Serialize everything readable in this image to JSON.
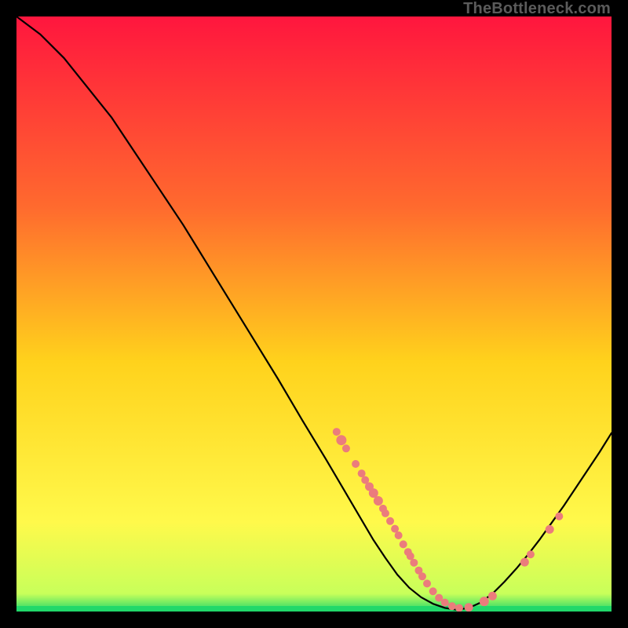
{
  "watermark": "TheBottleneck.com",
  "colors": {
    "curve": "#000000",
    "dots": "#eb7c7c",
    "green": "#21d86a",
    "gradient_top": "#ff163e",
    "gradient_mid_upper": "#ff6a2e",
    "gradient_mid": "#ffd21c",
    "gradient_mid_lower": "#fff94b",
    "gradient_bottom": "#21d86a",
    "frame": "#000000"
  },
  "chart_data": {
    "type": "line",
    "title": "",
    "xlabel": "",
    "ylabel": "",
    "xlim": [
      0,
      100
    ],
    "ylim": [
      0,
      100
    ],
    "curve": [
      {
        "x": 0,
        "y": 100
      },
      {
        "x": 4,
        "y": 97
      },
      {
        "x": 8,
        "y": 93
      },
      {
        "x": 12,
        "y": 88
      },
      {
        "x": 16,
        "y": 83
      },
      {
        "x": 20,
        "y": 77
      },
      {
        "x": 24,
        "y": 71
      },
      {
        "x": 28,
        "y": 65
      },
      {
        "x": 32,
        "y": 58.5
      },
      {
        "x": 36,
        "y": 52
      },
      {
        "x": 40,
        "y": 45.5
      },
      {
        "x": 44,
        "y": 39
      },
      {
        "x": 48,
        "y": 32.2
      },
      {
        "x": 52,
        "y": 25.6
      },
      {
        "x": 55,
        "y": 20.5
      },
      {
        "x": 58,
        "y": 15.4
      },
      {
        "x": 60,
        "y": 12
      },
      {
        "x": 62,
        "y": 9
      },
      {
        "x": 64,
        "y": 6.2
      },
      {
        "x": 66,
        "y": 4
      },
      {
        "x": 68,
        "y": 2.4
      },
      {
        "x": 70,
        "y": 1.3
      },
      {
        "x": 72,
        "y": 0.6
      },
      {
        "x": 74,
        "y": 0.3
      },
      {
        "x": 76,
        "y": 0.6
      },
      {
        "x": 78,
        "y": 1.5
      },
      {
        "x": 80,
        "y": 3
      },
      {
        "x": 82,
        "y": 5
      },
      {
        "x": 84,
        "y": 7.2
      },
      {
        "x": 86,
        "y": 9.6
      },
      {
        "x": 88,
        "y": 12.2
      },
      {
        "x": 90,
        "y": 15
      },
      {
        "x": 92,
        "y": 17.8
      },
      {
        "x": 94,
        "y": 20.8
      },
      {
        "x": 96,
        "y": 23.8
      },
      {
        "x": 98,
        "y": 26.8
      },
      {
        "x": 100,
        "y": 30
      }
    ],
    "dots": [
      {
        "x": 53.8,
        "y": 30.2,
        "r": 5
      },
      {
        "x": 54.6,
        "y": 28.8,
        "r": 6.5
      },
      {
        "x": 55.4,
        "y": 27.4,
        "r": 5
      },
      {
        "x": 57.0,
        "y": 24.8,
        "r": 5
      },
      {
        "x": 58.0,
        "y": 23.2,
        "r": 5
      },
      {
        "x": 58.6,
        "y": 22.1,
        "r": 5
      },
      {
        "x": 59.3,
        "y": 21.0,
        "r": 5.5
      },
      {
        "x": 60.0,
        "y": 19.9,
        "r": 6
      },
      {
        "x": 60.8,
        "y": 18.6,
        "r": 6
      },
      {
        "x": 61.6,
        "y": 17.3,
        "r": 5
      },
      {
        "x": 62.0,
        "y": 16.5,
        "r": 5
      },
      {
        "x": 62.8,
        "y": 15.2,
        "r": 5
      },
      {
        "x": 63.6,
        "y": 13.9,
        "r": 5
      },
      {
        "x": 64.2,
        "y": 12.8,
        "r": 5
      },
      {
        "x": 65.0,
        "y": 11.3,
        "r": 5
      },
      {
        "x": 65.8,
        "y": 10.0,
        "r": 5
      },
      {
        "x": 66.2,
        "y": 9.3,
        "r": 5
      },
      {
        "x": 66.8,
        "y": 8.2,
        "r": 5
      },
      {
        "x": 67.6,
        "y": 6.9,
        "r": 5
      },
      {
        "x": 68.2,
        "y": 5.9,
        "r": 5
      },
      {
        "x": 69.0,
        "y": 4.7,
        "r": 5
      },
      {
        "x": 70.0,
        "y": 3.4,
        "r": 5
      },
      {
        "x": 71.0,
        "y": 2.3,
        "r": 5
      },
      {
        "x": 72.0,
        "y": 1.5,
        "r": 5
      },
      {
        "x": 73.2,
        "y": 0.9,
        "r": 5
      },
      {
        "x": 74.4,
        "y": 0.6,
        "r": 5
      },
      {
        "x": 76.0,
        "y": 0.7,
        "r": 5.5
      },
      {
        "x": 78.6,
        "y": 1.7,
        "r": 6
      },
      {
        "x": 80.0,
        "y": 2.6,
        "r": 5.5
      },
      {
        "x": 85.4,
        "y": 8.3,
        "r": 5.5
      },
      {
        "x": 86.4,
        "y": 9.6,
        "r": 5
      },
      {
        "x": 89.6,
        "y": 13.8,
        "r": 5.5
      },
      {
        "x": 91.2,
        "y": 16.0,
        "r": 5
      }
    ]
  }
}
